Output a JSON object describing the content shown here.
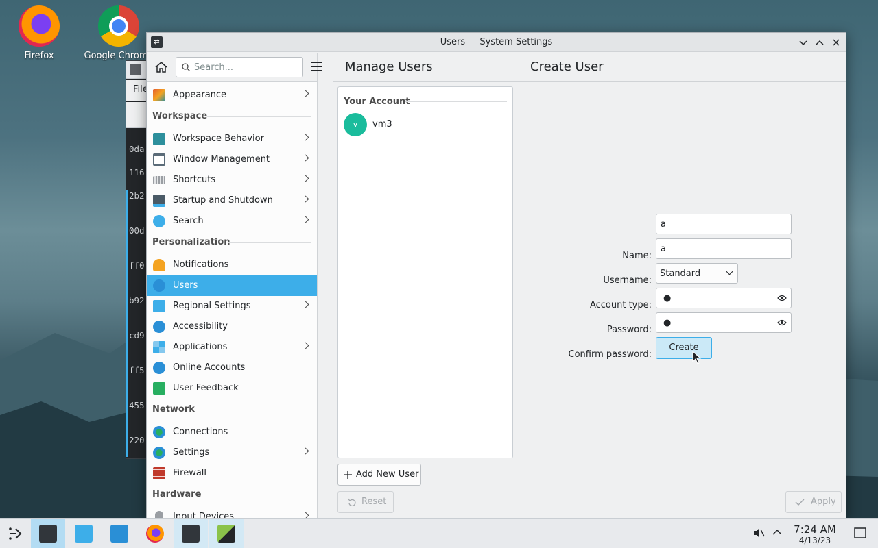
{
  "desktop": {
    "icons": [
      {
        "label": "Firefox",
        "icon": "firefox-icon"
      },
      {
        "label": "Google Chrome",
        "icon": "chrome-icon"
      }
    ]
  },
  "background_window": {
    "menu_label": "File",
    "lines": [
      "0da",
      "116",
      "2b2",
      "00d",
      "ff0",
      "b92",
      "cd9",
      "ff5",
      "455",
      "220"
    ]
  },
  "window": {
    "title": "Users — System Settings",
    "controls": [
      "minimize",
      "maximize",
      "close"
    ]
  },
  "sidebar": {
    "search_placeholder": "Search...",
    "top_items": [
      {
        "label": "Appearance",
        "has_arrow": true,
        "icon": "appearance-icon",
        "color": "#e35d2f"
      }
    ],
    "categories": [
      {
        "title": "Workspace",
        "items": [
          {
            "label": "Workspace Behavior",
            "has_arrow": true,
            "icon": "workspace-behavior-icon",
            "color": "#2d8f9c"
          },
          {
            "label": "Window Management",
            "has_arrow": true,
            "icon": "window-management-icon",
            "color": "#5a6b78"
          },
          {
            "label": "Shortcuts",
            "has_arrow": true,
            "icon": "keyboard-icon",
            "color": "#9a9ea3"
          },
          {
            "label": "Startup and Shutdown",
            "has_arrow": true,
            "icon": "startup-icon",
            "color": "#4a5a66"
          },
          {
            "label": "Search",
            "has_arrow": true,
            "icon": "search-icon",
            "color": "#3daee9"
          }
        ]
      },
      {
        "title": "Personalization",
        "items": [
          {
            "label": "Notifications",
            "has_arrow": false,
            "icon": "bell-icon",
            "color": "#f4a321"
          },
          {
            "label": "Users",
            "has_arrow": false,
            "icon": "users-icon",
            "color": "#2a8fd6",
            "selected": true
          },
          {
            "label": "Regional Settings",
            "has_arrow": true,
            "icon": "regional-icon",
            "color": "#3daee9"
          },
          {
            "label": "Accessibility",
            "has_arrow": false,
            "icon": "accessibility-icon",
            "color": "#2a8fd6"
          },
          {
            "label": "Applications",
            "has_arrow": true,
            "icon": "applications-icon",
            "color": "#3daee9"
          },
          {
            "label": "Online Accounts",
            "has_arrow": false,
            "icon": "online-accounts-icon",
            "color": "#2a8fd6"
          },
          {
            "label": "User Feedback",
            "has_arrow": false,
            "icon": "feedback-icon",
            "color": "#27ae60"
          }
        ]
      },
      {
        "title": "Network",
        "items": [
          {
            "label": "Connections",
            "has_arrow": false,
            "icon": "globe-icon",
            "color": "#2a8fd6"
          },
          {
            "label": "Settings",
            "has_arrow": true,
            "icon": "network-settings-icon",
            "color": "#2a8fd6"
          },
          {
            "label": "Firewall",
            "has_arrow": false,
            "icon": "firewall-icon",
            "color": "#c0392b"
          }
        ]
      },
      {
        "title": "Hardware",
        "items": [
          {
            "label": "Input Devices",
            "has_arrow": true,
            "icon": "mouse-icon",
            "color": "#9a9ea3"
          }
        ]
      }
    ]
  },
  "content": {
    "left_heading": "Manage Users",
    "right_heading": "Create User",
    "your_account_label": "Your Account",
    "current_user": {
      "initial": "v",
      "name": "vm3"
    },
    "add_user_label": "Add New User",
    "reset_label": "Reset",
    "apply_label": "Apply"
  },
  "form": {
    "name_label": "Name:",
    "name_value": "a",
    "username_label": "Username:",
    "username_value": "a",
    "account_type_label": "Account type:",
    "account_type_value": "Standard",
    "password_label": "Password:",
    "password_value": "●",
    "confirm_label": "Confirm password:",
    "confirm_value": "●",
    "create_label": "Create"
  },
  "taskbar": {
    "clock_time": "7:24 AM",
    "clock_date": "4/13/23",
    "colors": {
      "accent": "#3daee9",
      "active_task": "#b3dcf3"
    }
  }
}
